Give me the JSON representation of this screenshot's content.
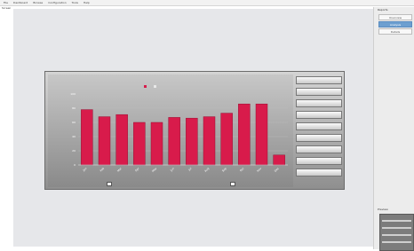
{
  "menu": [
    "File",
    "Dashboard",
    "Browse",
    "Configuration",
    "Tools",
    "Help"
  ],
  "window_title": "Screen",
  "right_panel": {
    "title": "Reports",
    "items": [
      "Overview",
      "Analysis",
      "Details"
    ],
    "selected_index": 1,
    "bottom_title": "Preview"
  },
  "chart_data": {
    "type": "bar",
    "title": "",
    "xlabel": "",
    "ylabel": "",
    "categories": [
      "Jan",
      "Feb",
      "Mar",
      "Apr",
      "May",
      "Jun",
      "Jul",
      "Aug",
      "Sep",
      "Oct",
      "Nov",
      "Dec"
    ],
    "series": [
      {
        "values": [
          78,
          68,
          71,
          60,
          60,
          67,
          66,
          68,
          73,
          86,
          86,
          14
        ]
      }
    ],
    "ylim": [
      0,
      100
    ],
    "grid": true,
    "legend": "top-center",
    "colors": {
      "bar": "#d81b4b",
      "bar_edge": "#9a0f33",
      "axis_text": "#ffffff"
    }
  },
  "side_buttons": [
    "",
    "",
    "",
    "",
    "",
    "",
    "",
    "",
    ""
  ],
  "download_icons": [
    "download-icon",
    "download-icon"
  ]
}
